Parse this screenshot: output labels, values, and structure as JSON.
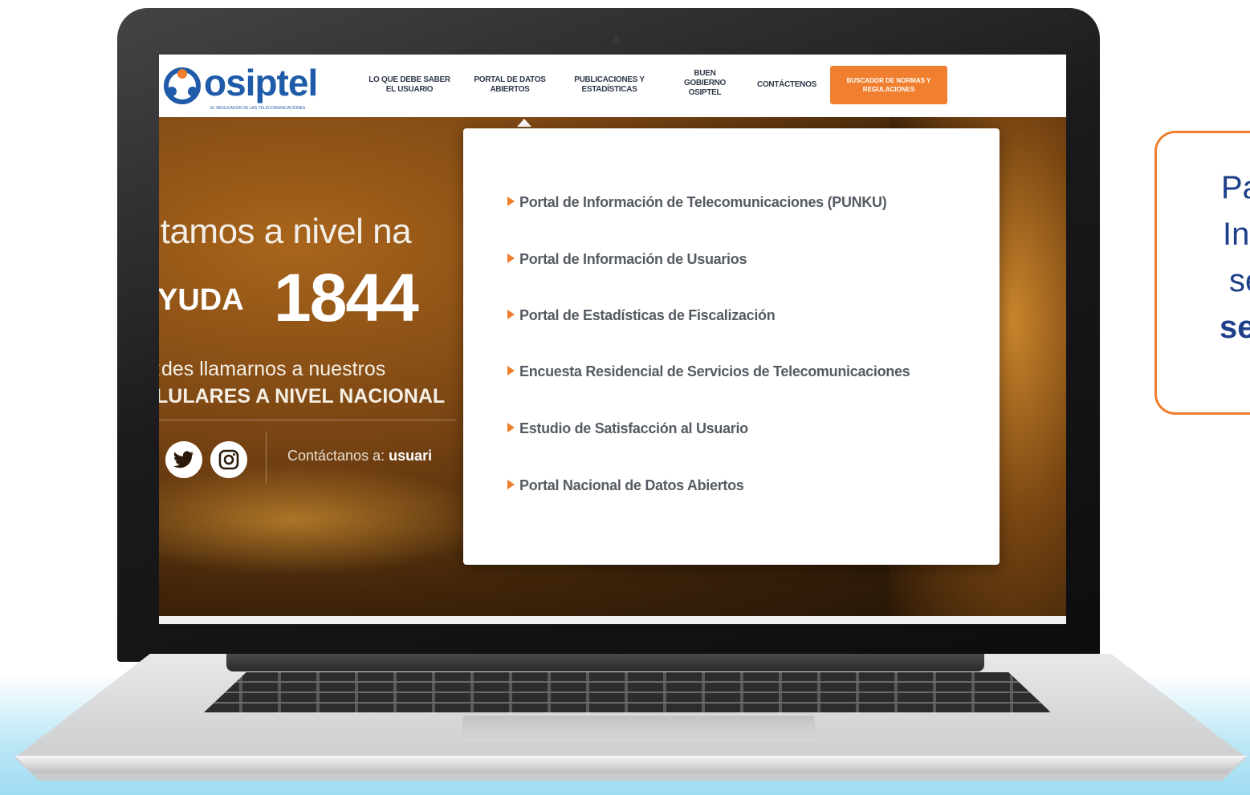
{
  "brand": {
    "name": "osiptel",
    "tagline": "EL REGULADOR DE LAS TELECOMUNICACIONES",
    "color": "#1f5ba8"
  },
  "nav": {
    "items": [
      {
        "line1": "LO QUE DEBE SABER",
        "line2": "EL USUARIO"
      },
      {
        "line1": "PORTAL DE DATOS",
        "line2": "ABIERTOS"
      },
      {
        "line1": "PUBLICACIONES Y",
        "line2": "ESTADÍSTICAS"
      }
    ],
    "buen_gobierno": {
      "line1": "BUEN",
      "line2": "GOBIERNO",
      "line3": "OSIPTEL"
    },
    "contactenos": "CONTÁCTENOS",
    "cta": "BUSCADOR DE NORMAS Y REGULACIONES",
    "cta_color": "#f08030"
  },
  "hero": {
    "line1": "ıtamos a nivel na",
    "yuda": "YUDA",
    "number": "1844",
    "line3": "ːdes llamarnos a nuestros",
    "line4": "LULARES A NIVEL NACIONAL",
    "contact_label": "Contáctanos a:",
    "contact_value": "usuari",
    "social_icons": [
      "twitter-icon",
      "instagram-icon"
    ]
  },
  "dropdown": {
    "items": [
      "Portal de Información de Telecomunicaciones (PUNKU)",
      "Portal de Información de Usuarios",
      "Portal de Estadísticas de Fiscalización",
      "Encuesta Residencial de Servicios de Telecomunicaciones",
      "Estudio de Satisfacción al Usuario",
      "Portal Nacional de Datos Abiertos"
    ],
    "bullet_color": "#ef7d2c"
  },
  "callout": {
    "lines": [
      "Pa",
      "In",
      "se",
      "se"
    ],
    "border_color": "#ef7d2c"
  }
}
